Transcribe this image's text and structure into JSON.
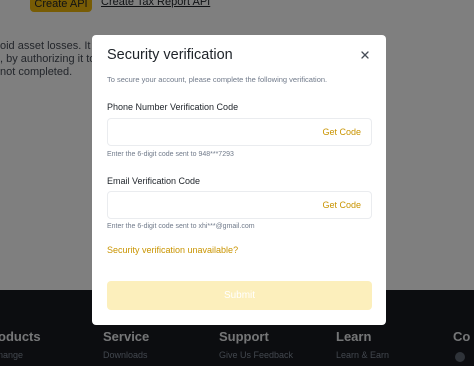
{
  "background": {
    "create_api_button": "Create API",
    "create_link": "Create Tax Report API",
    "text_lines": [
      "oid asset losses. It is rec",
      ", by authorizing it to a thi",
      "not completed."
    ],
    "footer": {
      "columns": [
        {
          "heading": "oducts",
          "link": "nange"
        },
        {
          "heading": "Service",
          "link": "Downloads"
        },
        {
          "heading": "Support",
          "link": "Give Us Feedback"
        },
        {
          "heading": "Learn",
          "link": "Learn & Earn"
        },
        {
          "heading": "Co",
          "link": ""
        }
      ]
    }
  },
  "modal": {
    "title": "Security verification",
    "subtitle": "To secure your account, please complete the following verification.",
    "phone": {
      "label": "Phone Number Verification Code",
      "value": "",
      "get_code": "Get Code",
      "hint": "Enter the 6-digit code sent to 948***7293"
    },
    "email": {
      "label": "Email Verification Code",
      "value": "",
      "get_code": "Get Code",
      "hint": "Enter the 6-digit code sent to xhi***@gmail.com"
    },
    "unavailable_link": "Security verification unavailable?",
    "submit_label": "Submit"
  },
  "colors": {
    "accent": "#c99400",
    "brand_yellow": "#f0b90b",
    "submit_disabled": "#fcefbc",
    "footer_bg": "#181a20"
  },
  "icons": {
    "close": "close-icon"
  }
}
